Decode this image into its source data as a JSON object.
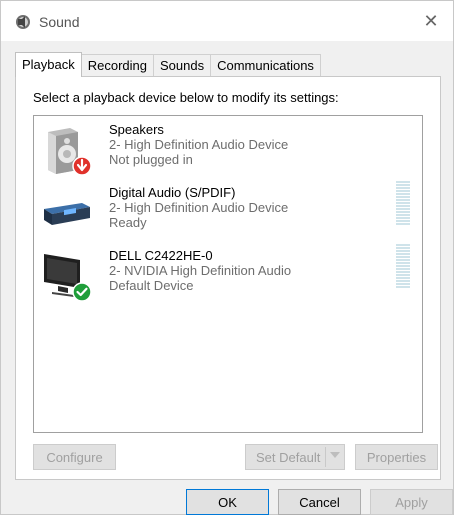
{
  "window": {
    "title": "Sound",
    "close_glyph": "✕"
  },
  "tabs": [
    {
      "label": "Playback",
      "active": true
    },
    {
      "label": "Recording"
    },
    {
      "label": "Sounds"
    },
    {
      "label": "Communications"
    }
  ],
  "instruction": "Select a playback device below to modify its settings:",
  "devices": [
    {
      "name": "Speakers",
      "description": "2- High Definition Audio Device",
      "status": "Not plugged in",
      "icon": "speaker-icon",
      "badge": "unplugged-badge-icon"
    },
    {
      "name": "Digital Audio (S/PDIF)",
      "description": "2- High Definition Audio Device",
      "status": "Ready",
      "icon": "digital-audio-receiver-icon"
    },
    {
      "name": "DELL C2422HE-0",
      "description": "2- NVIDIA High Definition Audio",
      "status": "Default Device",
      "icon": "monitor-icon",
      "badge": "default-check-badge-icon"
    }
  ],
  "buttons": {
    "configure": "Configure",
    "set_default": "Set Default",
    "properties": "Properties",
    "ok": "OK",
    "cancel": "Cancel",
    "apply": "Apply"
  },
  "colors": {
    "meter": "#cfe3ea",
    "badge_red": "#e0312b",
    "badge_green": "#1f9e3a"
  }
}
